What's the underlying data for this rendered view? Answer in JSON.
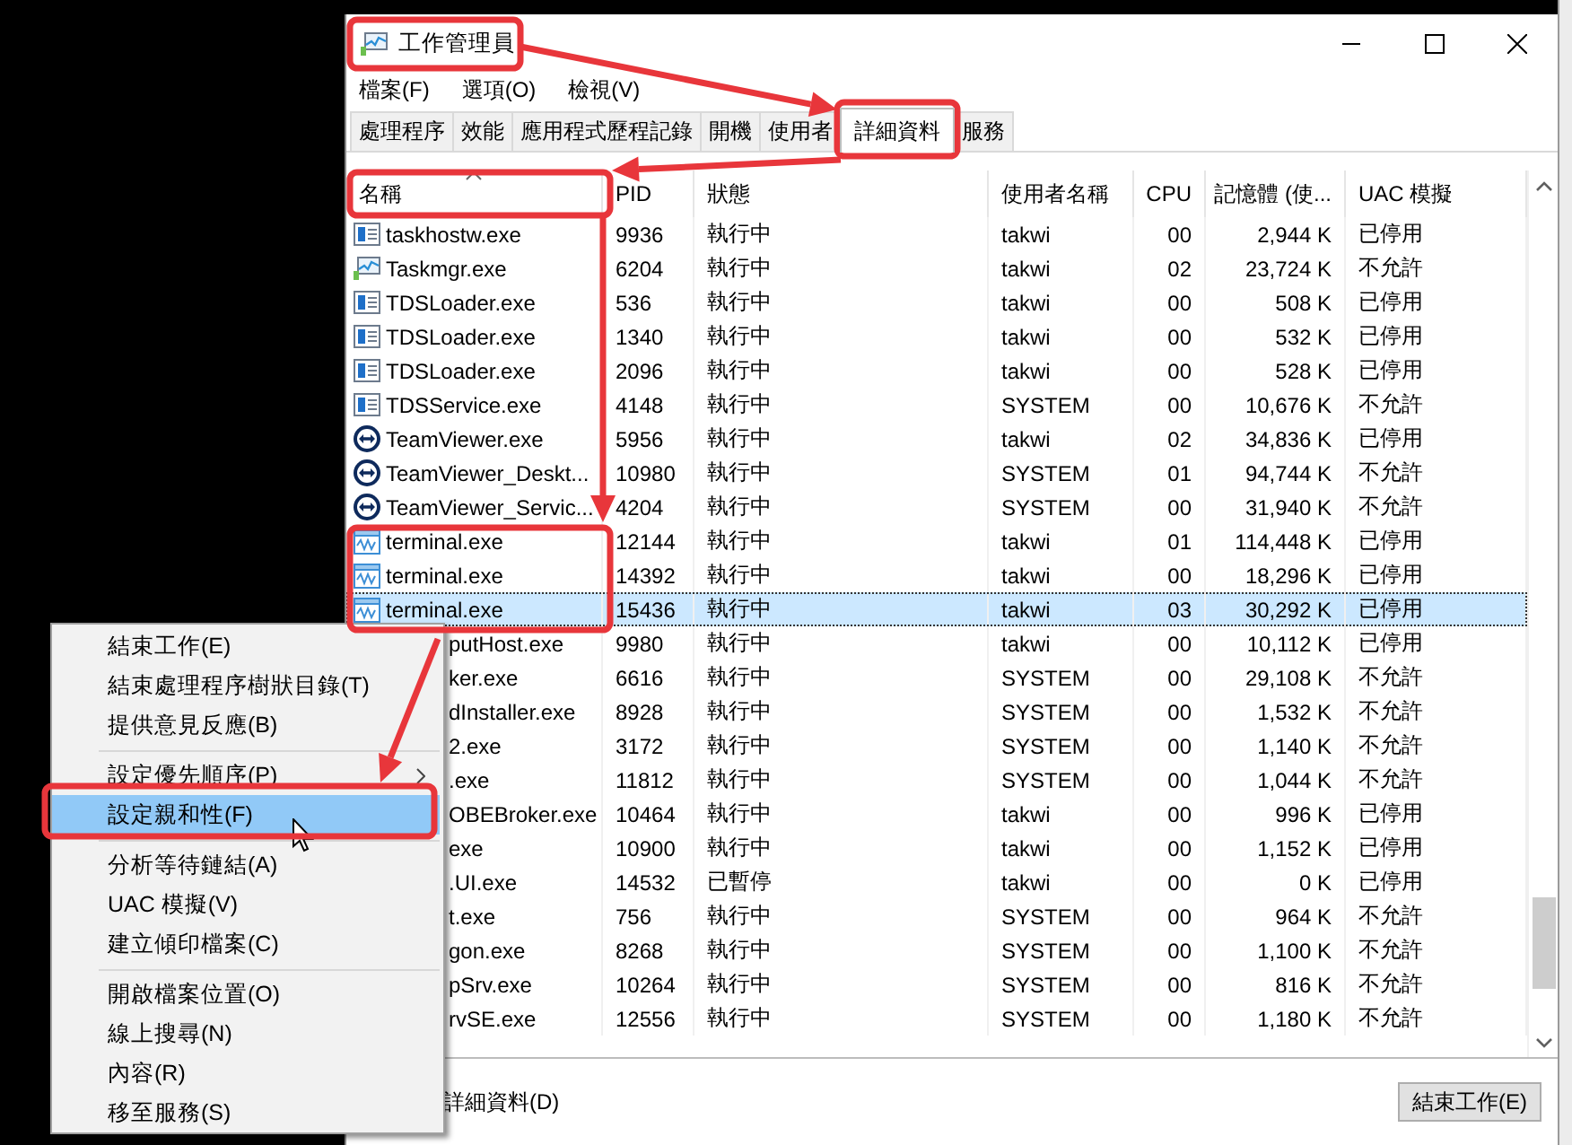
{
  "window": {
    "title": "工作管理員"
  },
  "menu_bar": [
    "檔案(F)",
    "選項(O)",
    "檢視(V)"
  ],
  "tabs": [
    {
      "label": "處理程序",
      "selected": false
    },
    {
      "label": "效能",
      "selected": false
    },
    {
      "label": "應用程式歷程記錄",
      "selected": false
    },
    {
      "label": "開機",
      "selected": false
    },
    {
      "label": "使用者",
      "selected": false
    },
    {
      "label": "詳細資料",
      "selected": true
    },
    {
      "label": "服務",
      "selected": false
    }
  ],
  "table": {
    "columns": [
      {
        "label": "名稱",
        "sorted": true
      },
      {
        "label": "PID",
        "sorted": false
      },
      {
        "label": "狀態",
        "sorted": false
      },
      {
        "label": "使用者名稱",
        "sorted": false
      },
      {
        "label": "CPU",
        "sorted": false
      },
      {
        "label": "記憶體 (使...",
        "sorted": false
      },
      {
        "label": "UAC 模擬",
        "sorted": false
      }
    ],
    "rows": [
      {
        "kind": "app",
        "name": "taskhostw.exe",
        "pid": "9936",
        "status": "執行中",
        "user": "takwi",
        "cpu": "00",
        "memory": "2,944 K",
        "uac": "已停用",
        "selected": false
      },
      {
        "kind": "monitor",
        "name": "Taskmgr.exe",
        "pid": "6204",
        "status": "執行中",
        "user": "takwi",
        "cpu": "02",
        "memory": "23,724 K",
        "uac": "不允許",
        "selected": false
      },
      {
        "kind": "app",
        "name": "TDSLoader.exe",
        "pid": "536",
        "status": "執行中",
        "user": "takwi",
        "cpu": "00",
        "memory": "508 K",
        "uac": "已停用",
        "selected": false
      },
      {
        "kind": "app",
        "name": "TDSLoader.exe",
        "pid": "1340",
        "status": "執行中",
        "user": "takwi",
        "cpu": "00",
        "memory": "532 K",
        "uac": "已停用",
        "selected": false
      },
      {
        "kind": "app",
        "name": "TDSLoader.exe",
        "pid": "2096",
        "status": "執行中",
        "user": "takwi",
        "cpu": "00",
        "memory": "528 K",
        "uac": "已停用",
        "selected": false
      },
      {
        "kind": "app",
        "name": "TDSService.exe",
        "pid": "4148",
        "status": "執行中",
        "user": "SYSTEM",
        "cpu": "00",
        "memory": "10,676 K",
        "uac": "不允許",
        "selected": false
      },
      {
        "kind": "remote",
        "name": "TeamViewer.exe",
        "pid": "5956",
        "status": "執行中",
        "user": "takwi",
        "cpu": "02",
        "memory": "34,836 K",
        "uac": "已停用",
        "selected": false
      },
      {
        "kind": "remote",
        "name": "TeamViewer_Deskt...",
        "pid": "10980",
        "status": "執行中",
        "user": "SYSTEM",
        "cpu": "01",
        "memory": "94,744 K",
        "uac": "不允許",
        "selected": false
      },
      {
        "kind": "remote",
        "name": "TeamViewer_Servic...",
        "pid": "4204",
        "status": "執行中",
        "user": "SYSTEM",
        "cpu": "00",
        "memory": "31,940 K",
        "uac": "不允許",
        "selected": false
      },
      {
        "kind": "terminal",
        "name": "terminal.exe",
        "pid": "12144",
        "status": "執行中",
        "user": "takwi",
        "cpu": "01",
        "memory": "114,448 K",
        "uac": "已停用",
        "selected": false
      },
      {
        "kind": "terminal",
        "name": "terminal.exe",
        "pid": "14392",
        "status": "執行中",
        "user": "takwi",
        "cpu": "00",
        "memory": "18,296 K",
        "uac": "已停用",
        "selected": false
      },
      {
        "kind": "terminal",
        "name": "terminal.exe",
        "pid": "15436",
        "status": "執行中",
        "user": "takwi",
        "cpu": "03",
        "memory": "30,292 K",
        "uac": "已停用",
        "selected": true
      },
      {
        "kind": "covered",
        "name": "putHost.exe",
        "pid": "9980",
        "status": "執行中",
        "user": "takwi",
        "cpu": "00",
        "memory": "10,112 K",
        "uac": "已停用",
        "selected": false
      },
      {
        "kind": "covered",
        "name": "ker.exe",
        "pid": "6616",
        "status": "執行中",
        "user": "SYSTEM",
        "cpu": "00",
        "memory": "29,108 K",
        "uac": "不允許",
        "selected": false
      },
      {
        "kind": "covered",
        "name": "dInstaller.exe",
        "pid": "8928",
        "status": "執行中",
        "user": "SYSTEM",
        "cpu": "00",
        "memory": "1,532 K",
        "uac": "不允許",
        "selected": false
      },
      {
        "kind": "covered",
        "name": "2.exe",
        "pid": "3172",
        "status": "執行中",
        "user": "SYSTEM",
        "cpu": "00",
        "memory": "1,140 K",
        "uac": "不允許",
        "selected": false
      },
      {
        "kind": "covered",
        "name": ".exe",
        "pid": "11812",
        "status": "執行中",
        "user": "SYSTEM",
        "cpu": "00",
        "memory": "1,044 K",
        "uac": "不允許",
        "selected": false
      },
      {
        "kind": "covered",
        "name": "OBEBroker.exe",
        "pid": "10464",
        "status": "執行中",
        "user": "takwi",
        "cpu": "00",
        "memory": "996 K",
        "uac": "已停用",
        "selected": false
      },
      {
        "kind": "covered",
        "name": "exe",
        "pid": "10900",
        "status": "執行中",
        "user": "takwi",
        "cpu": "00",
        "memory": "1,152 K",
        "uac": "已停用",
        "selected": false
      },
      {
        "kind": "covered",
        "name": ".UI.exe",
        "pid": "14532",
        "status": "已暫停",
        "user": "takwi",
        "cpu": "00",
        "memory": "0 K",
        "uac": "已停用",
        "selected": false
      },
      {
        "kind": "covered",
        "name": "t.exe",
        "pid": "756",
        "status": "執行中",
        "user": "SYSTEM",
        "cpu": "00",
        "memory": "964 K",
        "uac": "不允許",
        "selected": false
      },
      {
        "kind": "covered",
        "name": "gon.exe",
        "pid": "8268",
        "status": "執行中",
        "user": "SYSTEM",
        "cpu": "00",
        "memory": "1,100 K",
        "uac": "不允許",
        "selected": false
      },
      {
        "kind": "covered",
        "name": "pSrv.exe",
        "pid": "10264",
        "status": "執行中",
        "user": "SYSTEM",
        "cpu": "00",
        "memory": "816 K",
        "uac": "不允許",
        "selected": false
      },
      {
        "kind": "covered",
        "name": "rvSE.exe",
        "pid": "12556",
        "status": "執行中",
        "user": "SYSTEM",
        "cpu": "00",
        "memory": "1,180 K",
        "uac": "不允許",
        "selected": false
      }
    ]
  },
  "footer": {
    "details_toggle": "詳細資料(D)",
    "end_task_button": "結束工作(E)"
  },
  "context_menu": {
    "items": [
      {
        "kind": "item",
        "label": "結束工作(E)",
        "selected": false,
        "submenu": false
      },
      {
        "kind": "item",
        "label": "結束處理程序樹狀目錄(T)",
        "selected": false,
        "submenu": false
      },
      {
        "kind": "item",
        "label": "提供意見反應(B)",
        "selected": false,
        "submenu": false
      },
      {
        "kind": "separator"
      },
      {
        "kind": "item",
        "label": "設定優先順序(P)",
        "selected": false,
        "submenu": true
      },
      {
        "kind": "item",
        "label": "設定親和性(F)",
        "selected": true,
        "submenu": false
      },
      {
        "kind": "separator"
      },
      {
        "kind": "item",
        "label": "分析等待鏈結(A)",
        "selected": false,
        "submenu": false
      },
      {
        "kind": "item",
        "label": "UAC 模擬(V)",
        "selected": false,
        "submenu": false
      },
      {
        "kind": "item",
        "label": "建立傾印檔案(C)",
        "selected": false,
        "submenu": false
      },
      {
        "kind": "separator"
      },
      {
        "kind": "item",
        "label": "開啟檔案位置(O)",
        "selected": false,
        "submenu": false
      },
      {
        "kind": "item",
        "label": "線上搜尋(N)",
        "selected": false,
        "submenu": false
      },
      {
        "kind": "item",
        "label": "內容(R)",
        "selected": false,
        "submenu": false
      },
      {
        "kind": "item",
        "label": "移至服務(S)",
        "selected": false,
        "submenu": false
      }
    ]
  }
}
